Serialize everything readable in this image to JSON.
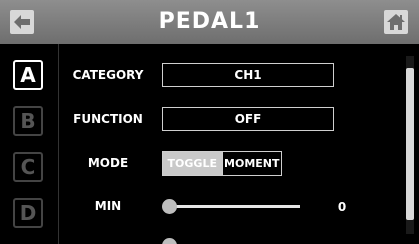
{
  "header": {
    "title": "PEDAL1",
    "back_icon": "back-arrow-icon",
    "home_icon": "home-icon",
    "colors": {
      "bar": "#7e7e7e",
      "button": "#d8d8d8"
    }
  },
  "sidebar": {
    "tabs": [
      {
        "label": "A",
        "active": true
      },
      {
        "label": "B",
        "active": false
      },
      {
        "label": "C",
        "active": false
      },
      {
        "label": "D",
        "active": false
      }
    ]
  },
  "settings": {
    "category": {
      "label": "CATEGORY",
      "value": "CH1"
    },
    "function": {
      "label": "FUNCTION",
      "value": "OFF"
    },
    "mode": {
      "label": "MODE",
      "options": [
        "TOGGLE",
        "MOMENT"
      ],
      "selected": "TOGGLE"
    },
    "min": {
      "label": "MIN",
      "value": "0",
      "level": 0
    }
  },
  "scrollbar": {
    "position": 0.06
  }
}
